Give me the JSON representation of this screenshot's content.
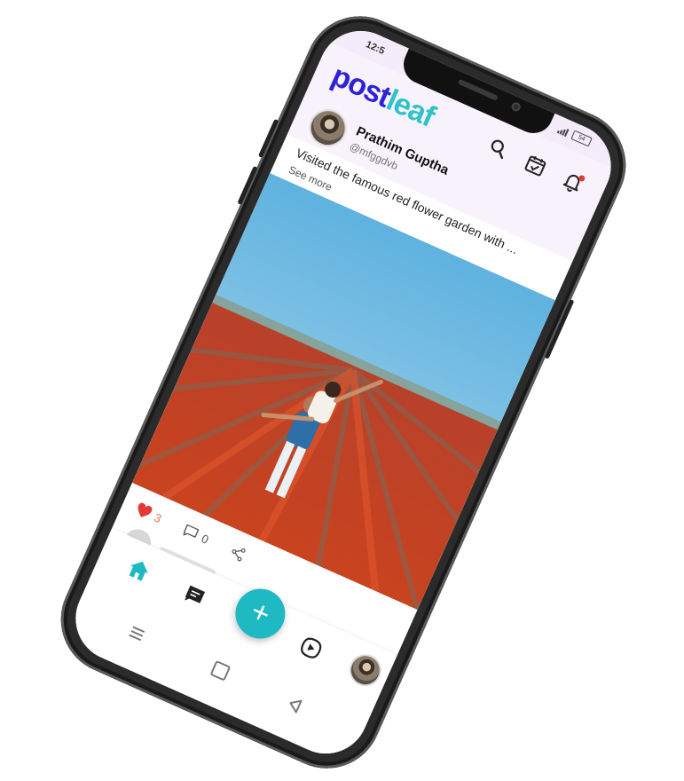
{
  "status_bar": {
    "time": "12:5",
    "battery": "54"
  },
  "app": {
    "logo_part1": "post",
    "logo_part2": "leaf",
    "brand_color": "#2e22d8",
    "accent_color": "#2ec3c8"
  },
  "header_icons": [
    "search-icon",
    "calendar-check-icon",
    "bell-icon"
  ],
  "post": {
    "author_name": "Prathim Guptha",
    "author_handle": "@mfggdvb",
    "caption": "Visited the famous red flower garden with ...",
    "see_more": "See more",
    "likes": "3",
    "comments": "0",
    "like_color": "#e53935"
  },
  "bottom_nav": {
    "fab_label": "+",
    "fab_color": "#1fb9c4"
  }
}
